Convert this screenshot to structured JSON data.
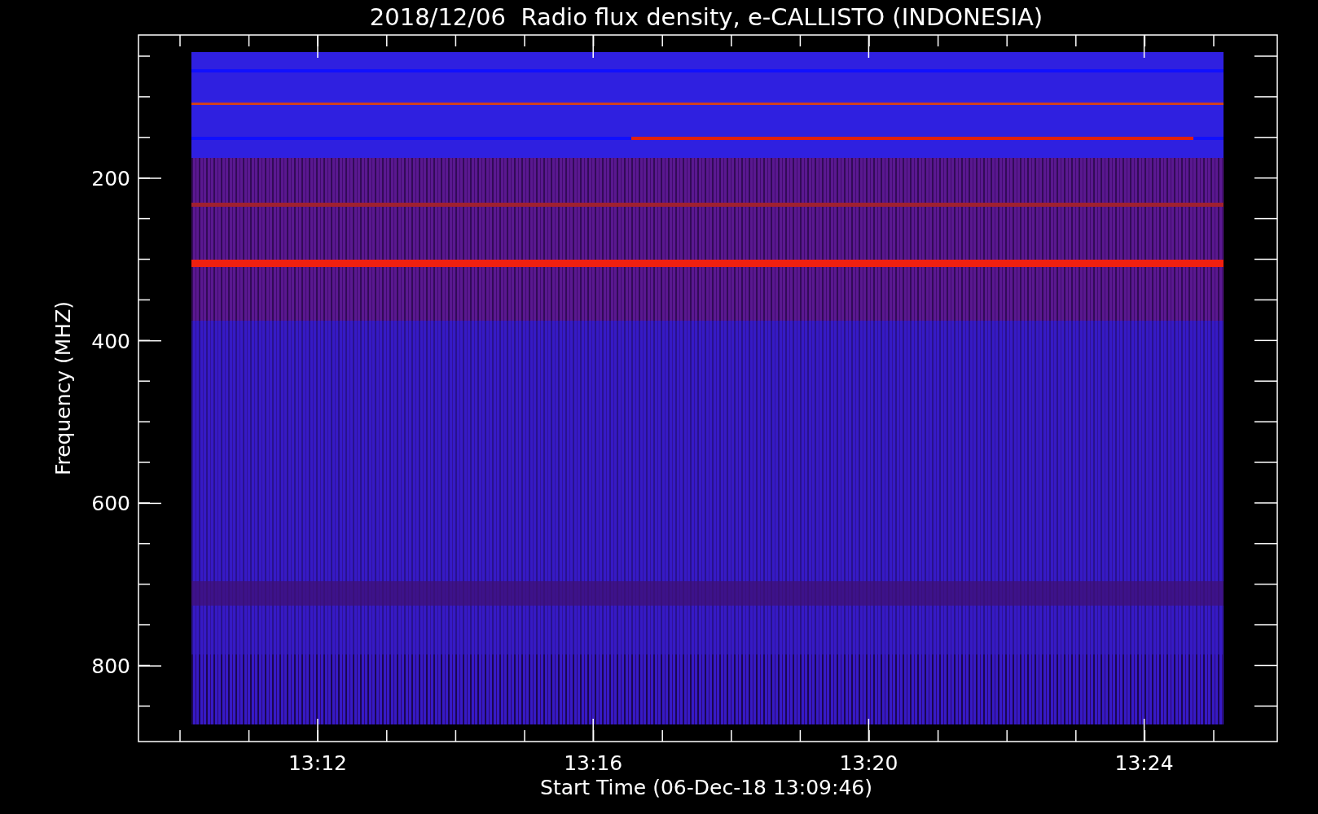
{
  "title": "2018/12/06  Radio flux density, e-CALLISTO (INDONESIA)",
  "plot": {
    "ylabel": "Frequency (MHZ)",
    "xlabel": "Start Time (06-Dec-18 13:09:46)",
    "yticks": [
      "200",
      "400",
      "600",
      "800"
    ],
    "xticks": [
      "13:12",
      "13:16",
      "13:20",
      "13:24"
    ],
    "kind": "picture"
  }
}
